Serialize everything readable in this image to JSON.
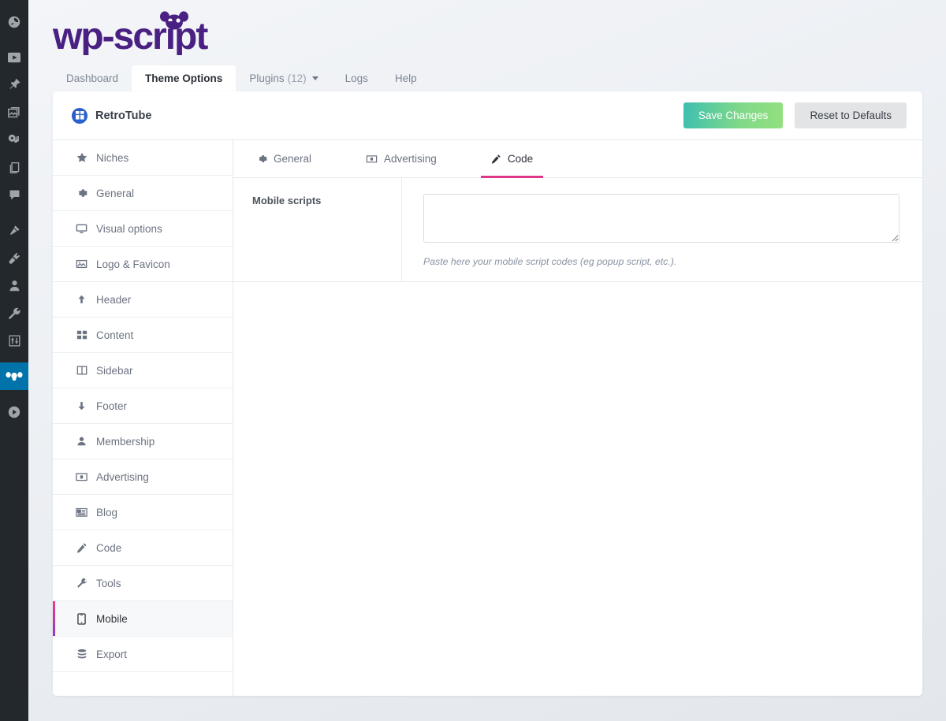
{
  "brand": {
    "name": "wp-script",
    "logo_color": "#4a2182"
  },
  "wp_adminbar": {
    "items": [
      {
        "name": "dashboard-icon",
        "label": "Dashboard"
      },
      {
        "name": "videos-icon",
        "label": "Videos"
      },
      {
        "name": "pin-icon",
        "label": "Posts"
      },
      {
        "name": "media-icon",
        "label": "Media"
      },
      {
        "name": "music-icon",
        "label": "Music"
      },
      {
        "name": "pages-icon",
        "label": "Pages"
      },
      {
        "name": "comments-icon",
        "label": "Comments"
      },
      {
        "name": "appearance-icon",
        "label": "Appearance"
      },
      {
        "name": "plugins-icon",
        "label": "Plugins"
      },
      {
        "name": "users-icon",
        "label": "Users"
      },
      {
        "name": "tools-icon",
        "label": "Tools"
      },
      {
        "name": "settings-icon",
        "label": "Settings"
      },
      {
        "name": "wp-script-panda-icon",
        "label": "wp-script",
        "active": true
      },
      {
        "name": "player-icon",
        "label": "Player"
      }
    ],
    "active_color": "#0073aa",
    "background": "#23282d"
  },
  "top_tabs": [
    {
      "label": "Dashboard",
      "active": false,
      "count": "",
      "has_caret": false
    },
    {
      "label": "Theme Options",
      "active": true,
      "count": "",
      "has_caret": false
    },
    {
      "label": "Plugins",
      "active": false,
      "count": "(12)",
      "has_caret": true
    },
    {
      "label": "Logs",
      "active": false,
      "count": "",
      "has_caret": false
    },
    {
      "label": "Help",
      "active": false,
      "count": "",
      "has_caret": false
    }
  ],
  "panel_header": {
    "theme_name": "RetroTube",
    "badge_icon": "theme-grid-icon",
    "save_label": "Save Changes",
    "reset_label": "Reset to Defaults",
    "save_gradient_from": "#3dbfb0",
    "save_gradient_to": "#93e07e"
  },
  "left_nav": {
    "active_accent_from": "#ec3b8a",
    "active_accent_to": "#8e3bbf",
    "items": [
      {
        "label": "Niches",
        "icon": "star-icon",
        "active": false
      },
      {
        "label": "General",
        "icon": "gear-icon",
        "active": false
      },
      {
        "label": "Visual options",
        "icon": "monitor-icon",
        "active": false
      },
      {
        "label": "Logo & Favicon",
        "icon": "image-icon",
        "active": false
      },
      {
        "label": "Header",
        "icon": "arrow-up-icon",
        "active": false
      },
      {
        "label": "Content",
        "icon": "grid-icon",
        "active": false
      },
      {
        "label": "Sidebar",
        "icon": "columns-icon",
        "active": false
      },
      {
        "label": "Footer",
        "icon": "arrow-down-icon",
        "active": false
      },
      {
        "label": "Membership",
        "icon": "user-icon",
        "active": false
      },
      {
        "label": "Advertising",
        "icon": "banknote-icon",
        "active": false
      },
      {
        "label": "Blog",
        "icon": "list-icon",
        "active": false
      },
      {
        "label": "Code",
        "icon": "pencil-icon",
        "active": false
      },
      {
        "label": "Tools",
        "icon": "wrench-icon",
        "active": false
      },
      {
        "label": "Mobile",
        "icon": "phone-icon",
        "active": true
      },
      {
        "label": "Export",
        "icon": "database-icon",
        "active": false
      }
    ]
  },
  "sub_tabs": {
    "active_underline": "#e0368a",
    "items": [
      {
        "label": "General",
        "icon": "gear-icon",
        "active": false
      },
      {
        "label": "Advertising",
        "icon": "banknote-icon",
        "active": false
      },
      {
        "label": "Code",
        "icon": "pencil-icon",
        "active": true
      }
    ]
  },
  "field": {
    "label": "Mobile scripts",
    "value": "",
    "placeholder": "",
    "help": "Paste here your mobile script codes (eg popup script, etc.)."
  }
}
